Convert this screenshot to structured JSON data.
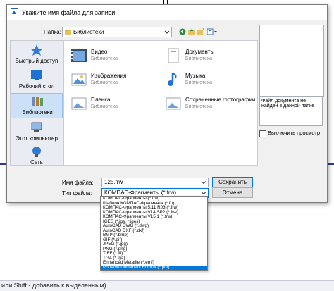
{
  "background": {
    "status_text": "или Shift - добавить к выделенным)"
  },
  "dialog": {
    "title": "Укажите имя файла для записи",
    "folder_label": "Папка:",
    "folder_value": "Библиотеки",
    "places": [
      {
        "label": "Быстрый доступ",
        "icon": "star-icon"
      },
      {
        "label": "Рабочий стол",
        "icon": "desktop-icon"
      },
      {
        "label": "Библиотеки",
        "icon": "libraries-icon",
        "selected": true
      },
      {
        "label": "Этот компьютер",
        "icon": "computer-icon"
      },
      {
        "label": "Сеть",
        "icon": "network-icon"
      }
    ],
    "items": [
      {
        "name": "Видео",
        "sub": "Библиотека",
        "icon": "video-library-icon"
      },
      {
        "name": "Документы",
        "sub": "Библиотека",
        "icon": "documents-library-icon"
      },
      {
        "name": "Изображения",
        "sub": "Библиотека",
        "icon": "pictures-library-icon"
      },
      {
        "name": "Музыка",
        "sub": "Библиотека",
        "icon": "music-library-icon"
      },
      {
        "name": "Пленка",
        "sub": "Библиотека",
        "icon": "camera-roll-library-icon"
      },
      {
        "name": "Сохраненные фотографии",
        "sub": "Библиотека",
        "icon": "saved-pictures-library-icon"
      }
    ],
    "preview_note": "Файл документа не найден в данной папке",
    "hide_preview_label": "Выключить просмотр",
    "filename_label": "Имя файла:",
    "filename_value": "125.frw",
    "filetype_label": "Тип файла:",
    "filetype_value": "КОМПАС-Фрагменты (*.frw)",
    "save_label": "Сохранить",
    "cancel_label": "Отмена"
  },
  "filetype_options": [
    "КОМПАС-Фрагменты (*.frw)",
    "Шаблон КОМПАС-Фрагмента (*.frt)",
    "КОМПАС-Фрагменты 5.11 R03 (*.frw)",
    "КОМПАС-Фрагменты V14 SP2 (*.frw)",
    "КОМПАС-Фрагменты V15.1 (*.frw)",
    "IGES (*.igs, *.iges)",
    "AutoCAD DWG (*.dwg)",
    "AutoCAD DXF (*.dxf)",
    "BMP (*.bmp)",
    "GIF (*.gif)",
    "JPEG (*.jpg)",
    "PNG (*.png)",
    "TIFF (*.tif)",
    "TGA (*.tga)",
    "Enhanced Metafile (*.emf)",
    "Portable Document Format (*.pdf)"
  ],
  "selected_option_index": 15,
  "colors": {
    "selection": "#0078d7",
    "places_selected": "#cce0f7"
  }
}
